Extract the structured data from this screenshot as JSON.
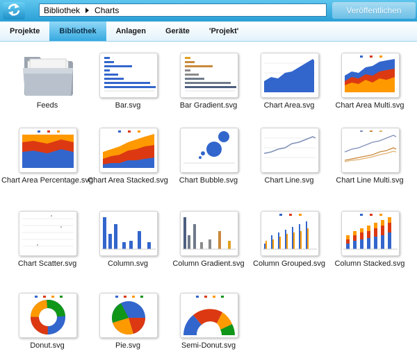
{
  "header": {
    "breadcrumb": [
      "Bibliothek",
      "Charts"
    ],
    "publish_label": "Veröffentlichen",
    "refresh_icon": "refresh-icon"
  },
  "tabs": [
    {
      "label": "Projekte",
      "active": false
    },
    {
      "label": "Bibliothek",
      "active": true
    },
    {
      "label": "Anlagen",
      "active": false
    },
    {
      "label": "Geräte",
      "active": false
    },
    {
      "label": "'Projekt'",
      "active": false
    }
  ],
  "items": [
    {
      "label": "Feeds",
      "kind": "folder"
    },
    {
      "label": "Bar.svg",
      "kind": "bar"
    },
    {
      "label": "Bar Gradient.svg",
      "kind": "bar-gradient"
    },
    {
      "label": "Chart Area.svg",
      "kind": "area"
    },
    {
      "label": "Chart Area Multi.svg",
      "kind": "area-multi"
    },
    {
      "label": "Chart Area Percentage.svg",
      "kind": "area-percentage"
    },
    {
      "label": "Chart Area Stacked.svg",
      "kind": "area-stacked"
    },
    {
      "label": "Chart Bubble.svg",
      "kind": "bubble"
    },
    {
      "label": "Chart Line.svg",
      "kind": "line"
    },
    {
      "label": "Chart Line Multi.svg",
      "kind": "line-multi"
    },
    {
      "label": "Chart Scatter.svg",
      "kind": "scatter"
    },
    {
      "label": "Column.svg",
      "kind": "column"
    },
    {
      "label": "Column Gradient.svg",
      "kind": "column-gradient"
    },
    {
      "label": "Column Grouped.svg",
      "kind": "column-grouped"
    },
    {
      "label": "Column Stacked.svg",
      "kind": "column-stacked"
    },
    {
      "label": "Donut.svg",
      "kind": "donut"
    },
    {
      "label": "Pie.svg",
      "kind": "pie"
    },
    {
      "label": "Semi-Donut.svg",
      "kind": "semi-donut"
    }
  ],
  "colors": {
    "header_blue": "#2a9fd6",
    "tab_active": "#36a9e0",
    "series_blue": "#3366cc",
    "series_red": "#dc3912",
    "series_orange": "#ff9900",
    "series_green": "#109618",
    "series_gray": "#6f7a8a",
    "series_gold": "#c9893c"
  }
}
